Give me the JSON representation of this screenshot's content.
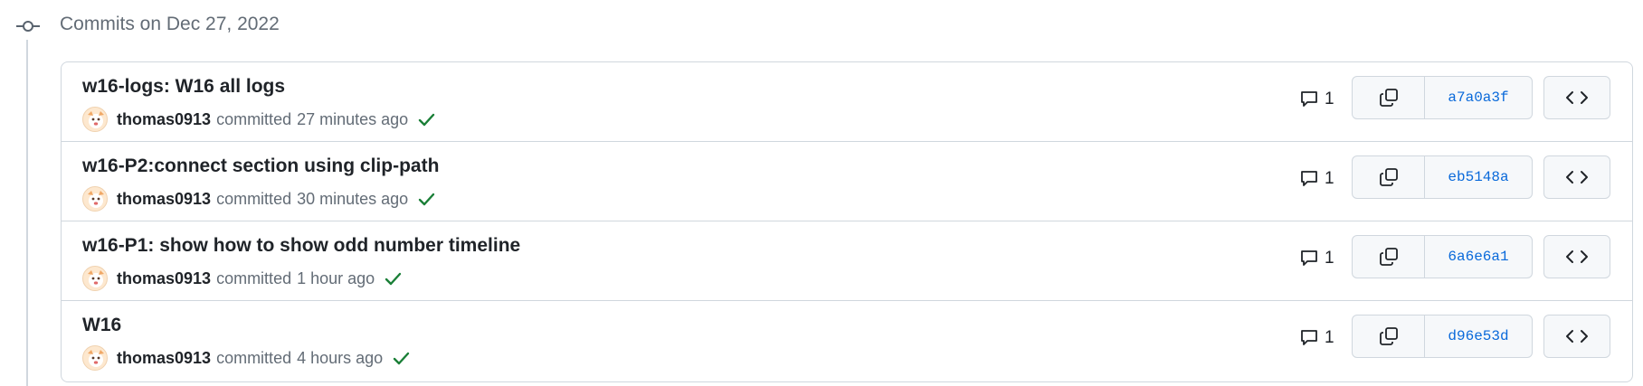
{
  "group": {
    "title": "Commits on Dec 27, 2022",
    "icon": "git-commit-icon"
  },
  "commits": [
    {
      "title": "w16-logs: W16 all logs",
      "author": "thomas0913",
      "verb": "committed",
      "time": "27 minutes ago",
      "comments": "1",
      "sha": "a7a0a3f"
    },
    {
      "title": "w16-P2:connect section using clip-path",
      "author": "thomas0913",
      "verb": "committed",
      "time": "30 minutes ago",
      "comments": "1",
      "sha": "eb5148a"
    },
    {
      "title": "w16-P1: show how to show odd number timeline",
      "author": "thomas0913",
      "verb": "committed",
      "time": "1 hour ago",
      "comments": "1",
      "sha": "6a6e6a1"
    },
    {
      "title": "W16",
      "author": "thomas0913",
      "verb": "committed",
      "time": "4 hours ago",
      "comments": "1",
      "sha": "d96e53d"
    }
  ],
  "colors": {
    "check": "#1a7f37",
    "sha_link": "#0969da",
    "border": "#d0d7de"
  }
}
